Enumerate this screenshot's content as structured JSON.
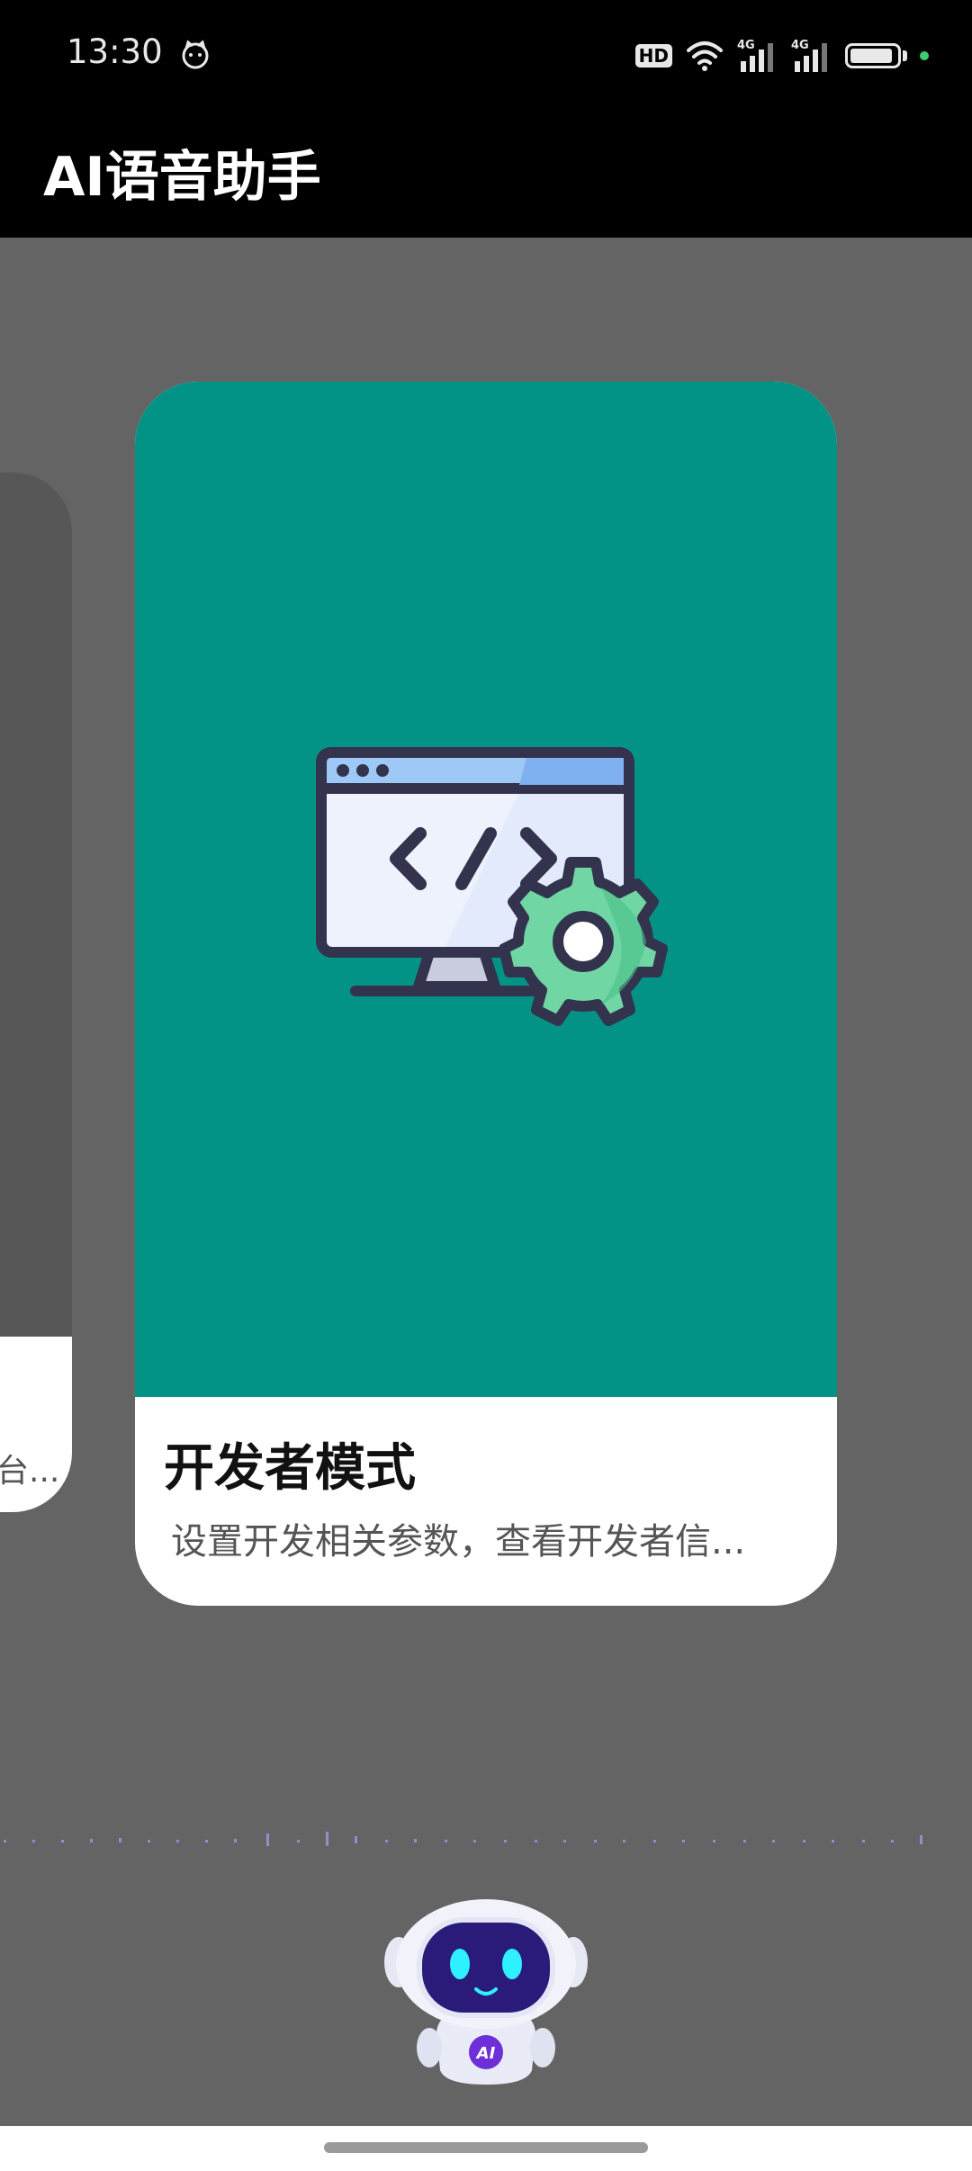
{
  "status_bar": {
    "time": "13:30",
    "hd_label": "HD",
    "network_1": "4G",
    "network_2": "4G"
  },
  "app_bar": {
    "title": "AI语音助手"
  },
  "carousel": {
    "side_card": {
      "description": "台..."
    },
    "main_card": {
      "title": "开发者模式",
      "description": "设置开发相关参数，查看开发者信..."
    }
  },
  "assistant": {
    "badge": "AI"
  },
  "colors": {
    "card_background": "#029386",
    "page_background": "#646464",
    "app_bar": "#000000",
    "charge_indicator": "#3ccf72"
  }
}
